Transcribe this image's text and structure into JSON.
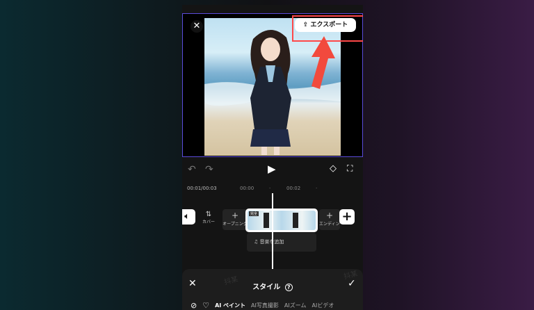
{
  "preview": {
    "close_icon": "close-icon",
    "export_label": "エクスポート",
    "export_icon": "upload-icon"
  },
  "toolbar": {
    "undo_icon": "undo-icon",
    "redo_icon": "redo-icon",
    "play_icon": "play-icon",
    "keyframe_icon": "keyframe-icon",
    "fullscreen_icon": "fullscreen-icon"
  },
  "timeline": {
    "timecode": "00:01/00:03",
    "ticks": [
      "00:00",
      "00:02"
    ],
    "mute_icon": "speaker-icon",
    "cover_label": "カバー",
    "opening_label": "オープニング",
    "ending_label": "エンディング",
    "clip_tag": "完全",
    "add_icon": "plus-icon",
    "music_label": "音楽を追加",
    "music_icon": "music-note-icon"
  },
  "bottom": {
    "cancel_icon": "close-icon",
    "title": "スタイル",
    "help_icon": "help-icon",
    "confirm_icon": "check-icon",
    "watermark": "抖某",
    "tabs": [
      {
        "icon": "none-icon"
      },
      {
        "icon": "heart-icon"
      },
      {
        "label": "AI ペイント",
        "active": true
      },
      {
        "label": "AI写真撮影"
      },
      {
        "label": "AIズーム"
      },
      {
        "label": "AIビデオ"
      }
    ]
  },
  "colors": {
    "accent_border": "#5b4bdb",
    "highlight": "#ff4848"
  }
}
